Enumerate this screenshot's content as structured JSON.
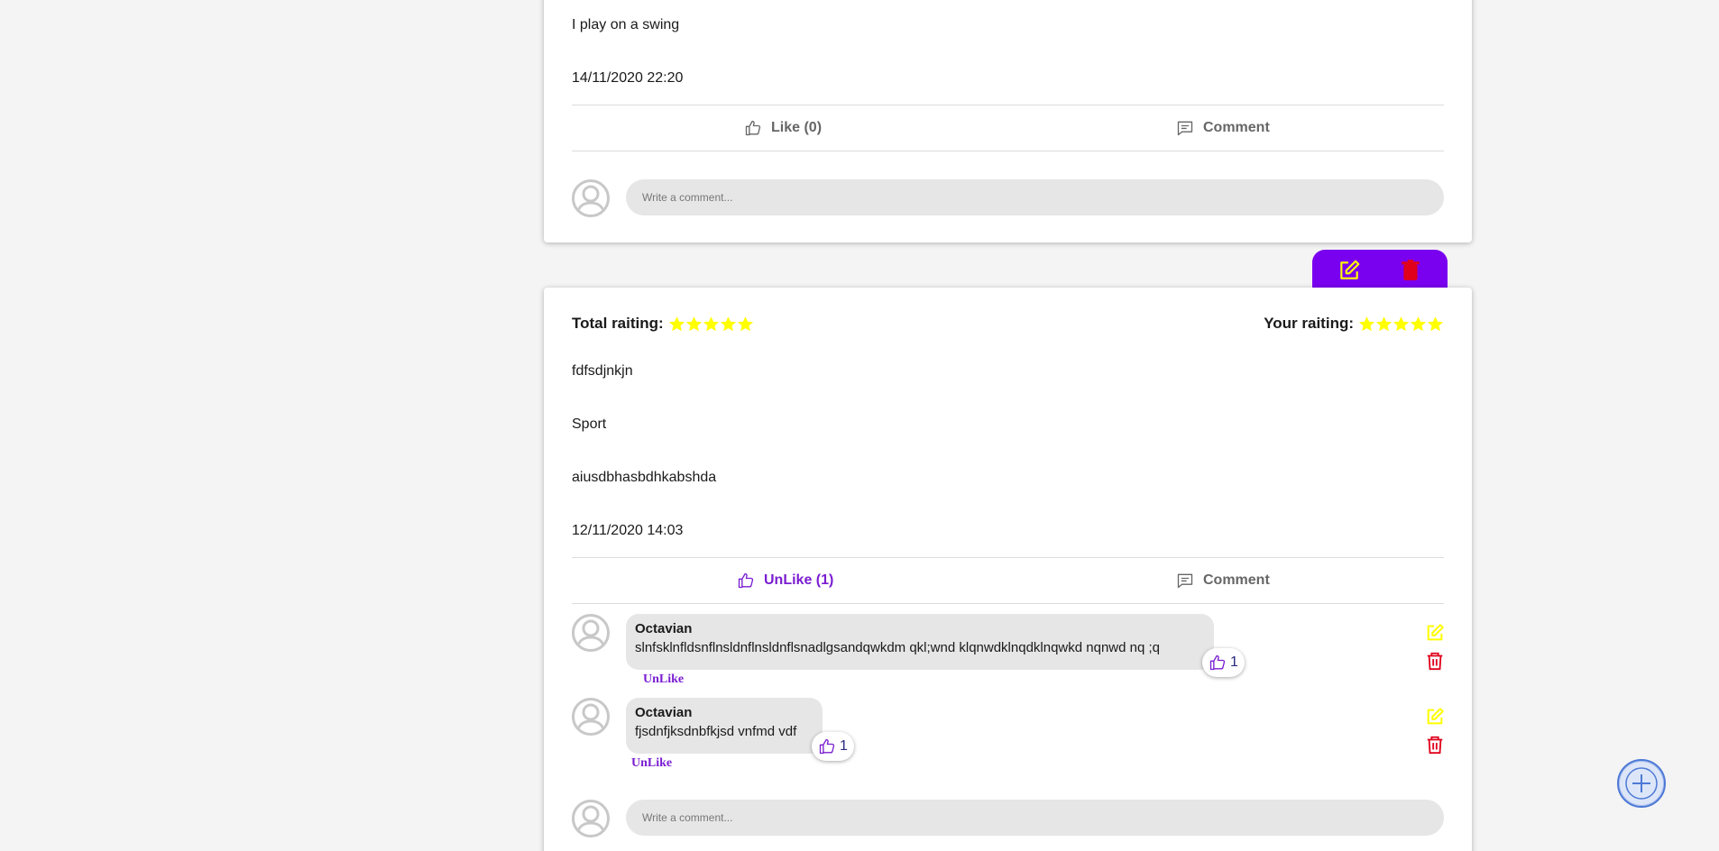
{
  "posts": [
    {
      "text_lines": [
        "I play on a swing"
      ],
      "date": "14/11/2020 22:20",
      "like_label": "Like (0)",
      "comment_label": "Comment",
      "comment_placeholder": "Write a comment..."
    },
    {
      "total_rating_label": "Total raiting:",
      "total_rating": 5,
      "your_rating_label": "Your raiting:",
      "your_rating": 5,
      "title": "fdfsdjnkjn",
      "category": "Sport",
      "description": "aiusdbhasbdhkabshda",
      "date": "12/11/2020 14:03",
      "like_label": "UnLike (1)",
      "comment_label": "Comment",
      "comment_placeholder": "Write a comment...",
      "comments": [
        {
          "author": "Octavian",
          "text": "slnfsklnfldsnflnsldnflnsldnflsnadlgsandqwkdm qkl;wnd klqnwdklnqdklnqwkd nqnwd nq ;q",
          "likes": "1",
          "unlike_label": "UnLike"
        },
        {
          "author": "Octavian",
          "text": "fjsdnfjksdnbfkjsd vnfmd vdf",
          "likes": "1",
          "unlike_label": "UnLike"
        }
      ]
    }
  ],
  "colors": {
    "accent_purple": "#7a00f0",
    "liked_purple": "#7a1dd1",
    "star_yellow": "#ffff00",
    "edit_yellow": "#ffff00",
    "delete_red": "#e0001b"
  },
  "icons": {
    "like": "thumbs-up-icon",
    "comment": "comment-icon",
    "edit": "edit-icon",
    "delete": "trash-icon",
    "add": "plus-icon",
    "avatar": "user-avatar-icon"
  }
}
